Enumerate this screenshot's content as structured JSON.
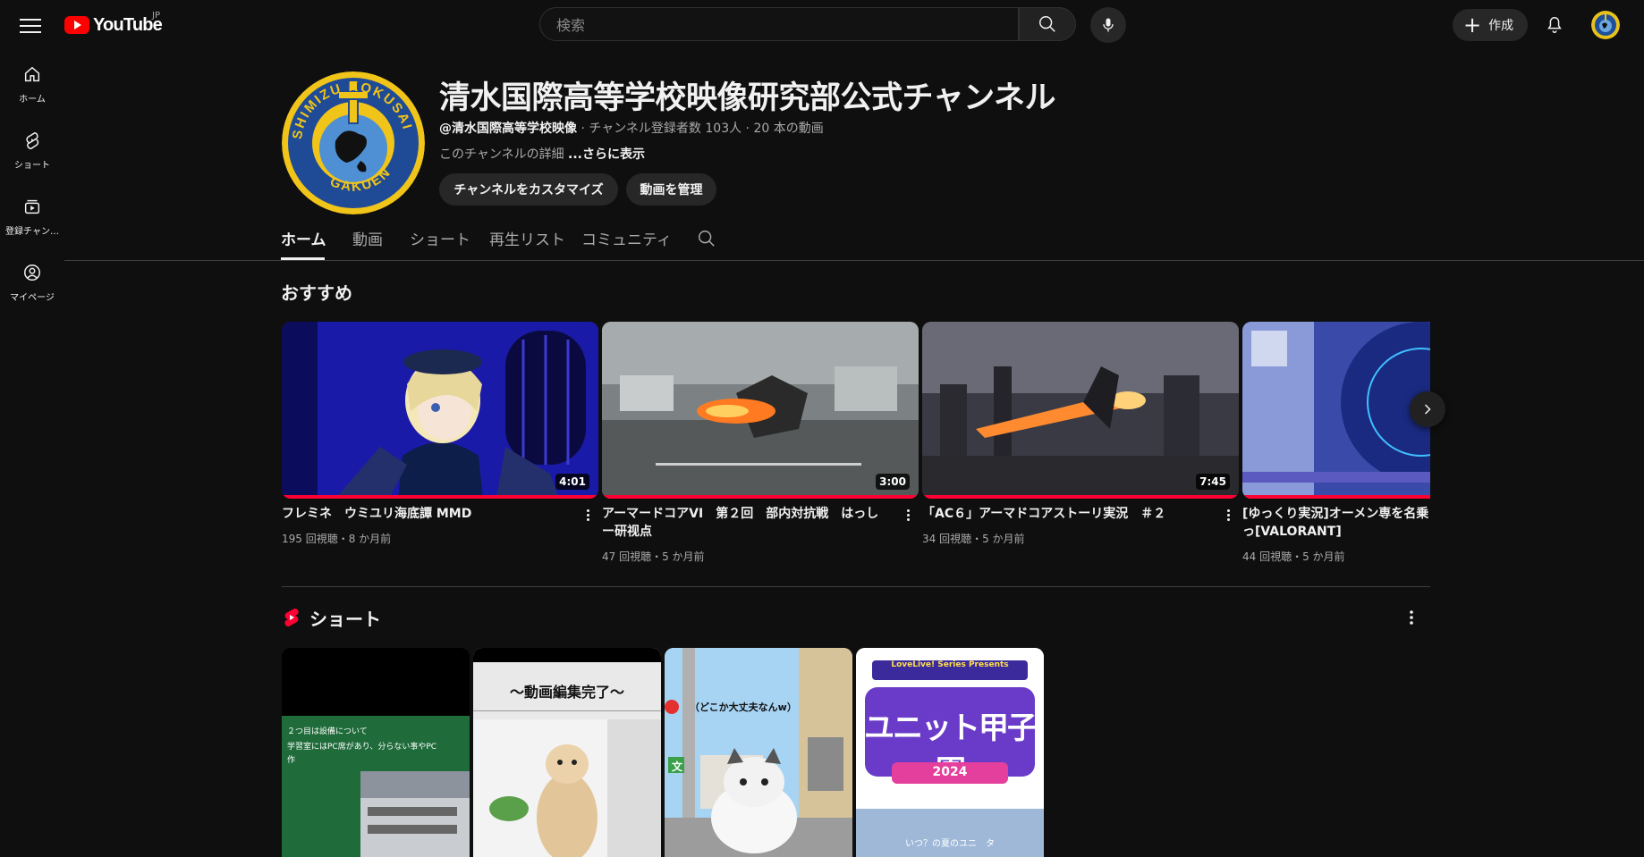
{
  "topbar": {
    "logo_text": "YouTube",
    "country_code": "JP",
    "search_placeholder": "検索",
    "create_label": "作成"
  },
  "sidebar": {
    "items": [
      {
        "label": "ホーム",
        "icon": "home-icon"
      },
      {
        "label": "ショート",
        "icon": "shorts-icon"
      },
      {
        "label": "登録チャン…",
        "icon": "subscriptions-icon"
      },
      {
        "label": "マイページ",
        "icon": "you-icon"
      }
    ]
  },
  "channel": {
    "title": "清水国際高等学校映像研究部公式チャンネル",
    "handle": "@清水国際高等学校映像",
    "meta": " · チャンネル登録者数 103人 · 20 本の動画",
    "description": "このチャンネルの詳細 ",
    "more_label": "...さらに表示",
    "customize_label": "チャンネルをカスタマイズ",
    "manage_label": "動画を管理",
    "logo_text_top": "SHIMIZU KOKUSAI",
    "logo_text_bottom": "GAKUEN"
  },
  "tabs": [
    {
      "label": "ホーム",
      "active": true
    },
    {
      "label": "動画",
      "active": false
    },
    {
      "label": "ショート",
      "active": false
    },
    {
      "label": "再生リスト",
      "active": false
    },
    {
      "label": "コミュニティ",
      "active": false
    }
  ],
  "recommended": {
    "title": "おすすめ",
    "videos": [
      {
        "title": "フレミネ　ウミユリ海底譚 MMD",
        "duration": "4:01",
        "meta": "195 回視聴・8 か月前"
      },
      {
        "title": "アーマードコアVI　第２回　部内対抗戦　はっしー研视点",
        "duration": "3:00",
        "meta": "47 回視聴・5 か月前"
      },
      {
        "title": "「AC６」アーマドコアストーリ実況　＃２",
        "duration": "7:45",
        "meta": "34 回視聴・5 か月前"
      },
      {
        "title": "[ゆっくり実況]オーメン専を名乗っ[VALORANT]",
        "duration": "",
        "meta": "44 回視聴・5 か月前"
      }
    ]
  },
  "shorts": {
    "title": "ショート",
    "items": [
      {
        "caption_line1": "２つ目は設備について",
        "caption_line2": "学習室にはPC席があり、分らない事やPC",
        "caption_line3": "作"
      },
      {
        "caption": "〜動画編集完了〜"
      },
      {
        "caption": "（どこか大丈夫なんw）",
        "sign": "文"
      },
      {
        "brand": "LoveLive! Series Presents",
        "title": "ユニット甲子園",
        "year": "2024",
        "caption": "いつ？の夏のユニ　タ"
      }
    ]
  },
  "colors": {
    "background": "#0f0f0f",
    "brand_red": "#ff0000",
    "progress_red": "#ff0033",
    "chip_bg": "#272727",
    "muted_text": "#aaaaaa"
  }
}
